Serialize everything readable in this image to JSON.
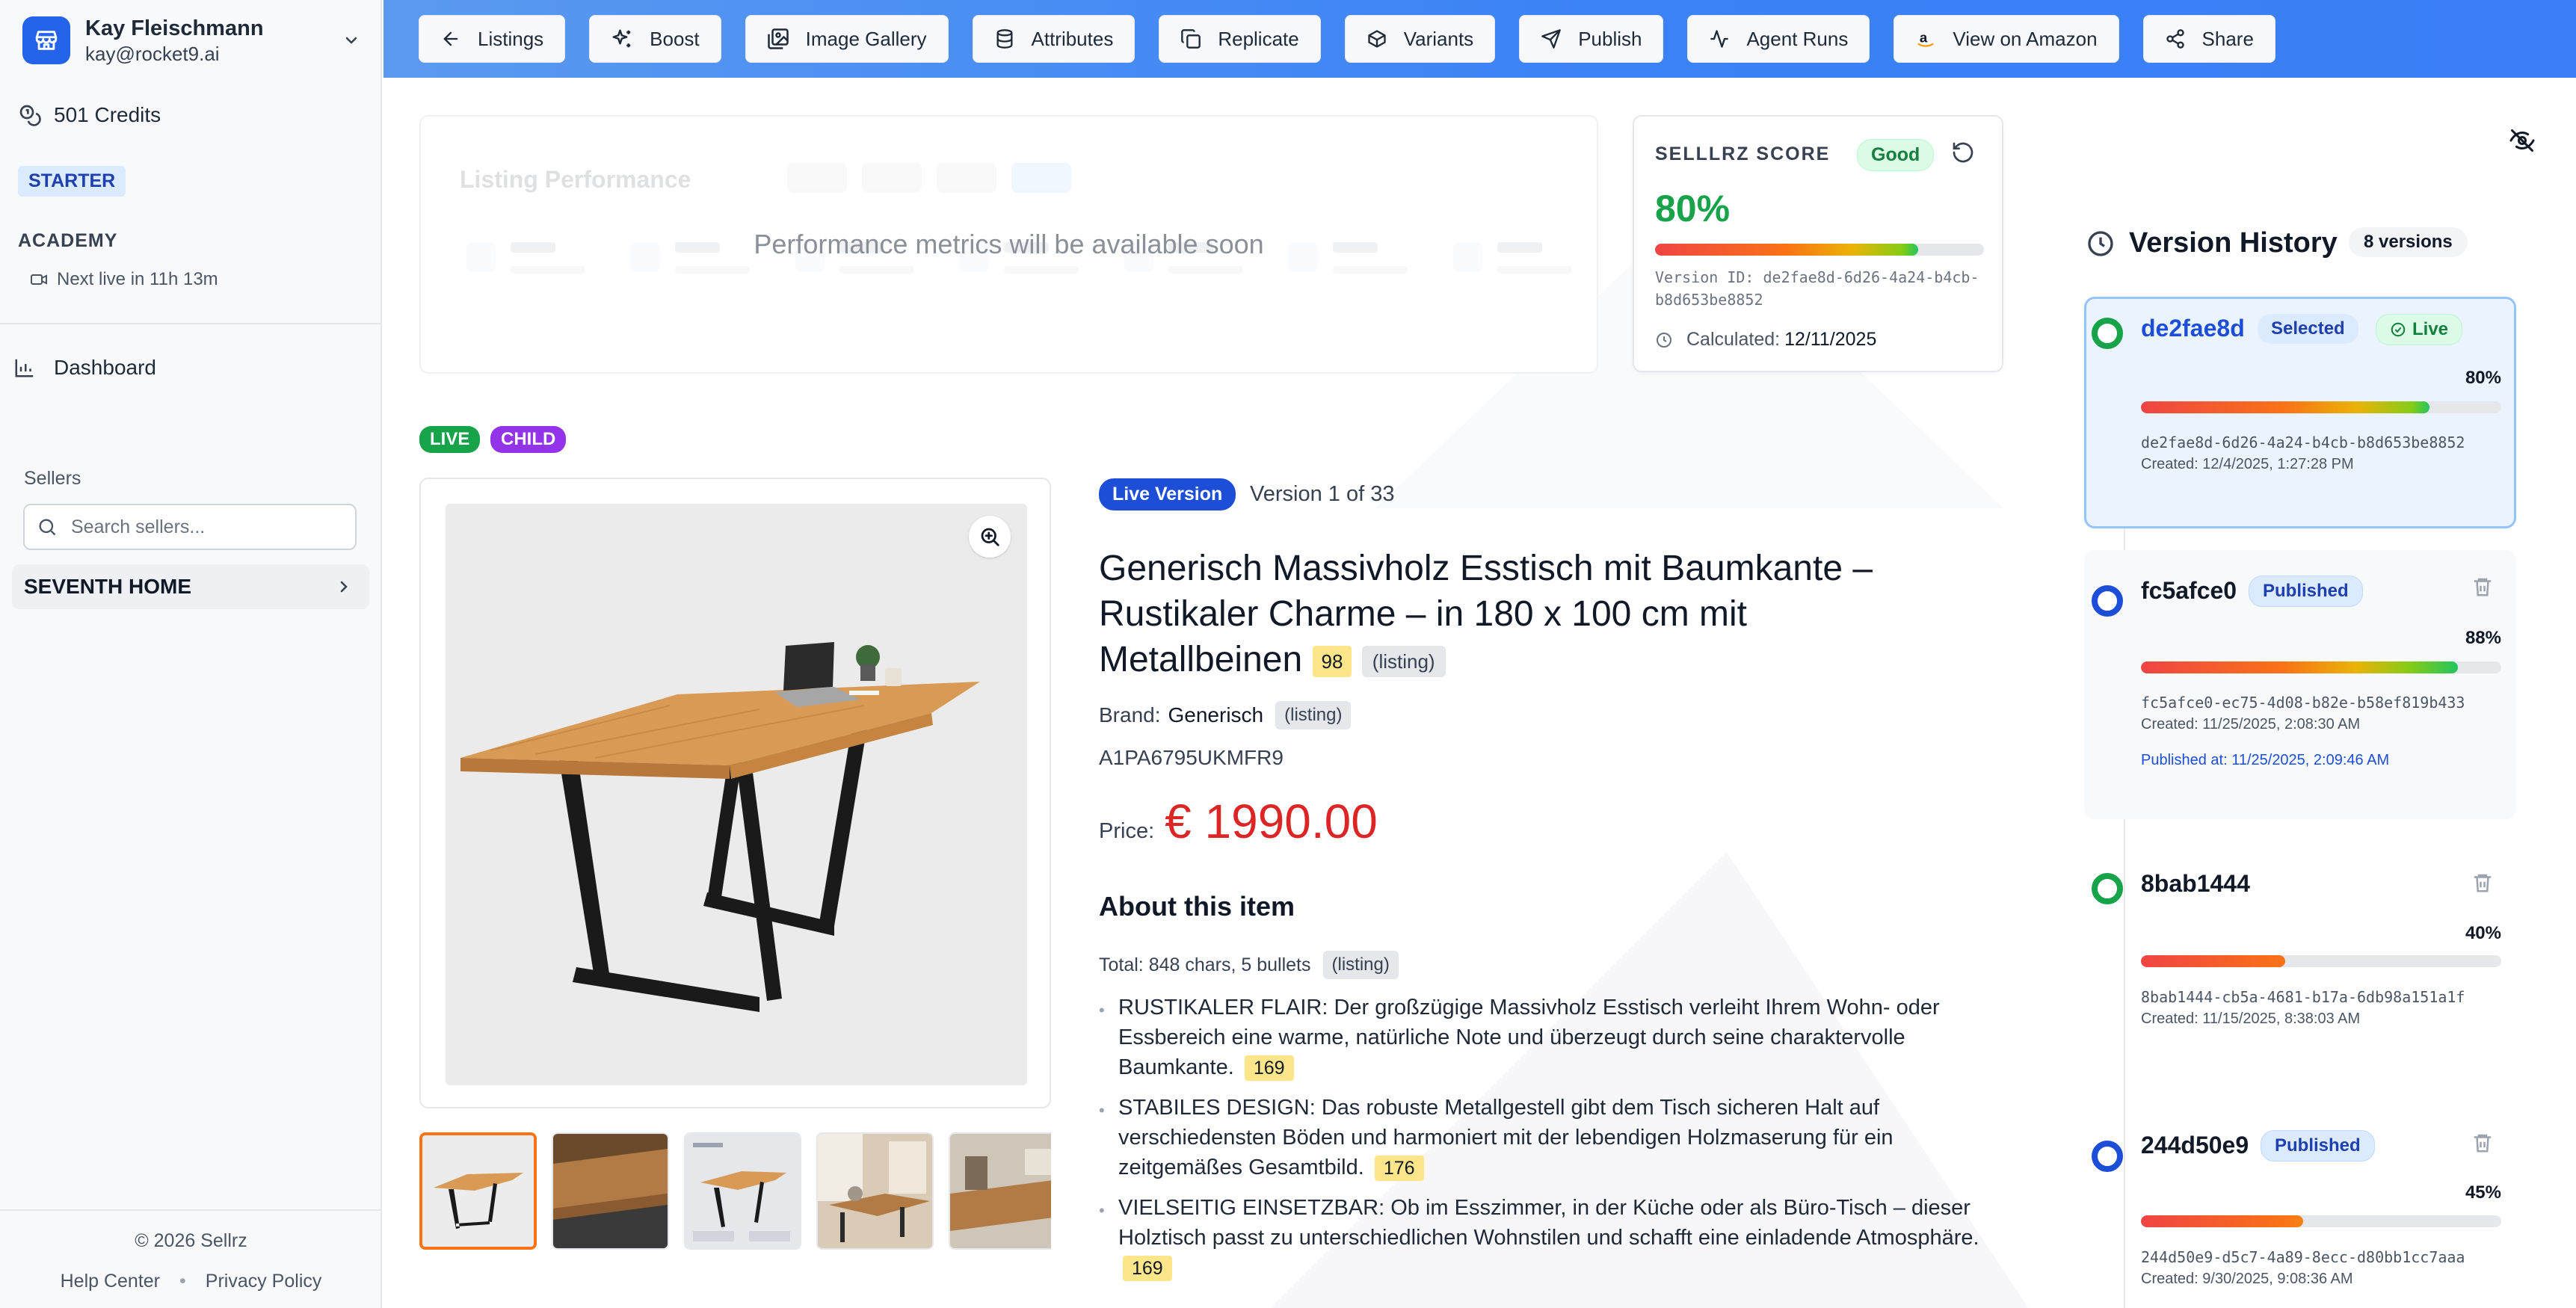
{
  "user": {
    "name": "Kay Fleischmann",
    "email": "kay@rocket9.ai"
  },
  "sidebar": {
    "credits": "501 Credits",
    "plan": "STARTER",
    "academy_label": "ACADEMY",
    "academy_live": "Next live in 11h 13m",
    "dashboard": "Dashboard",
    "sellers_label": "Sellers",
    "seller_search_placeholder": "Search sellers...",
    "seller_item": "SEVENTH HOME",
    "footer_copyright": "© 2026 Sellrz",
    "footer_help": "Help Center",
    "footer_privacy": "Privacy Policy"
  },
  "toolbar": {
    "buttons": [
      {
        "label": "Listings",
        "icon": "arrow-left-icon"
      },
      {
        "label": "Boost",
        "icon": "sparkles-icon"
      },
      {
        "label": "Image Gallery",
        "icon": "images-icon"
      },
      {
        "label": "Attributes",
        "icon": "database-icon"
      },
      {
        "label": "Replicate",
        "icon": "copy-icon"
      },
      {
        "label": "Variants",
        "icon": "box-icon"
      },
      {
        "label": "Publish",
        "icon": "send-icon"
      },
      {
        "label": "Agent Runs",
        "icon": "activity-icon"
      },
      {
        "label": "View on Amazon",
        "icon": "amazon-icon"
      },
      {
        "label": "Share",
        "icon": "share-icon"
      }
    ]
  },
  "performance": {
    "ghost_title": "Listing Performance",
    "message": "Performance metrics will be available soon"
  },
  "score": {
    "title": "SELLLRZ SCORE",
    "badge": "Good",
    "percent": "80%",
    "percent_value": 80,
    "version_id": "Version ID: de2fae8d-6d26-4a24-b4cb-b8d653be8852",
    "calculated_label": "Calculated:",
    "calculated_value": "12/11/2025"
  },
  "listing": {
    "badge_live": "LIVE",
    "badge_child": "CHILD",
    "live_version": "Live Version",
    "version_of": "Version 1 of 33",
    "title": "Generisch Massivholz Esstisch mit Baumkante – Rustikaler Charme – in 180 x 100 cm mit Metallbeinen",
    "title_score": "98",
    "title_source": "(listing)",
    "brand_label": "Brand:",
    "brand_value": "Generisch",
    "brand_source": "(listing)",
    "asin": "A1PA6795UKMFR9",
    "price_label": "Price:",
    "price": "€ 1990.00",
    "about_heading": "About this item",
    "total": "Total: 848 chars, 5 bullets",
    "total_source": "(listing)",
    "bullets": [
      {
        "text": "RUSTIKALER FLAIR: Der großzügige Massivholz Esstisch verleiht Ihrem Wohn- oder Essbereich eine warme, natürliche Note und überzeugt durch seine charaktervolle Baumkante.",
        "score": "169"
      },
      {
        "text": "STABILES DESIGN: Das robuste Metallgestell gibt dem Tisch sicheren Halt auf verschiedensten Böden und harmoniert mit der lebendigen Holzmaserung für ein zeitgemäßes Gesamtbild.",
        "score": "176"
      },
      {
        "text": "VIELSEITIG EINSETZBAR: Ob im Esszimmer, in der Küche oder als Büro-Tisch – dieser Holztisch passt zu unterschiedlichen Wohnstilen und schafft eine einladende Atmosphäre.",
        "score": "169"
      }
    ]
  },
  "version_history": {
    "title": "Version History",
    "count": "8 versions",
    "versions": [
      {
        "short": "de2fae8d",
        "tag": "Selected",
        "tag2": "Live",
        "percent": "80%",
        "percent_value": 80,
        "full_id": "de2fae8d-6d26-4a24-b4cb-b8d653be8852",
        "created": "Created: 12/4/2025, 1:27:28 PM"
      },
      {
        "short": "fc5afce0",
        "tag": "Published",
        "percent": "88%",
        "percent_value": 88,
        "full_id": "fc5afce0-ec75-4d08-b82e-b58ef819b433",
        "created": "Created: 11/25/2025, 2:08:30 AM",
        "published_at": "Published at: 11/25/2025, 2:09:46 AM"
      },
      {
        "short": "8bab1444",
        "percent": "40%",
        "percent_value": 40,
        "full_id": "8bab1444-cb5a-4681-b17a-6db98a151a1f",
        "created": "Created: 11/15/2025, 8:38:03 AM"
      },
      {
        "short": "244d50e9",
        "tag": "Published",
        "percent": "45%",
        "percent_value": 45,
        "full_id": "244d50e9-d5c7-4a89-8ecc-d80bb1cc7aaa",
        "created": "Created: 9/30/2025, 9:08:36 AM"
      }
    ]
  },
  "colors": {
    "accent": "#2563eb",
    "topbar": "#3b82f6",
    "price": "#dc2626",
    "score_good": "#16a34a",
    "chip_yellow": "#fde68a"
  }
}
